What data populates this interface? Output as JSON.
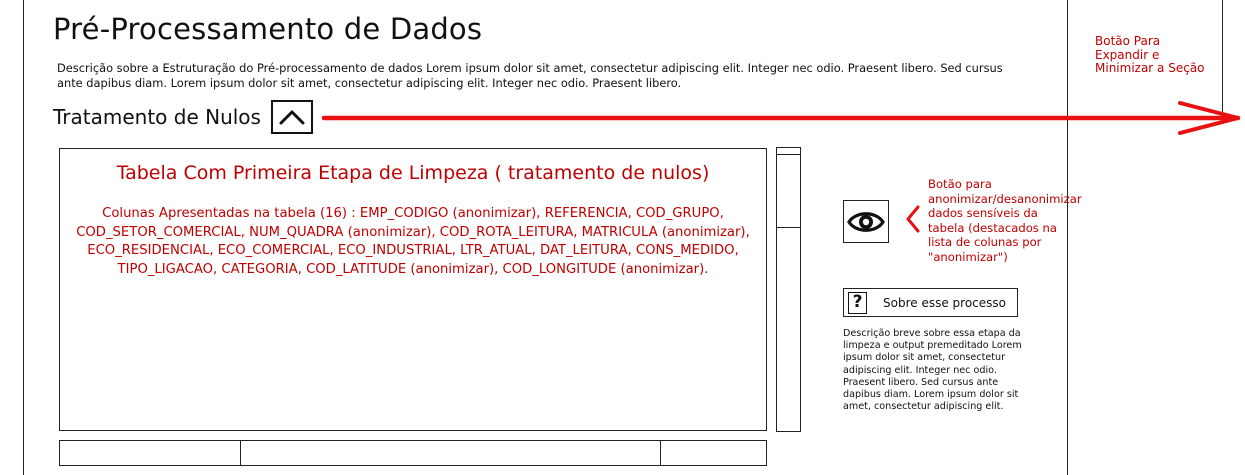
{
  "page": {
    "title": "Pré-Processamento de Dados",
    "description": "Descrição sobre a Estruturação do Pré-processamento de dados Lorem ipsum dolor sit amet, consectetur adipiscing elit. Integer nec odio. Praesent libero. Sed cursus ante dapibus diam. Lorem ipsum dolor sit amet, consectetur adipiscing elit. Integer nec odio. Praesent libero."
  },
  "section": {
    "title": "Tratamento de Nulos",
    "toggle_icon": "chevron-up-icon"
  },
  "table": {
    "title": "Tabela Com Primeira Etapa de Limpeza ( tratamento de nulos)",
    "columns_text": "Colunas Apresentadas na tabela (16) : EMP_CODIGO (anonimizar), REFERENCIA, COD_GRUPO, COD_SETOR_COMERCIAL, NUM_QUADRA (anonimizar), COD_ROTA_LEITURA, MATRICULA (anonimizar), ECO_RESIDENCIAL, ECO_COMERCIAL, ECO_INDUSTRIAL, LTR_ATUAL, DAT_LEITURA, CONS_MEDIDO, TIPO_LIGACAO, CATEGORIA, COD_LATITUDE (anonimizar), COD_LONGITUDE (anonimizar)."
  },
  "anonymize": {
    "icon": "eye-icon",
    "note": "Botão para anonimizar/desanonimizar dados sensíveis da tabela (destacados na lista de colunas por \"anonimizar\")"
  },
  "about": {
    "icon": "question-icon",
    "icon_glyph": "?",
    "button_label": "Sobre esse processo",
    "text": "Descrição breve sobre essa etapa da limpeza e output premeditado Lorem ipsum dolor sit amet, consectetur adipiscing elit. Integer nec odio. Praesent libero. Sed cursus ante dapibus diam. Lorem ipsum dolor sit amet, consectetur adipiscing elit."
  },
  "annotation": {
    "note": "Botão Para Expandir e Minimizar a Seção"
  },
  "colors": {
    "annotation_red": "#c00000",
    "arrow_red": "#e81010",
    "border": "#222222"
  }
}
